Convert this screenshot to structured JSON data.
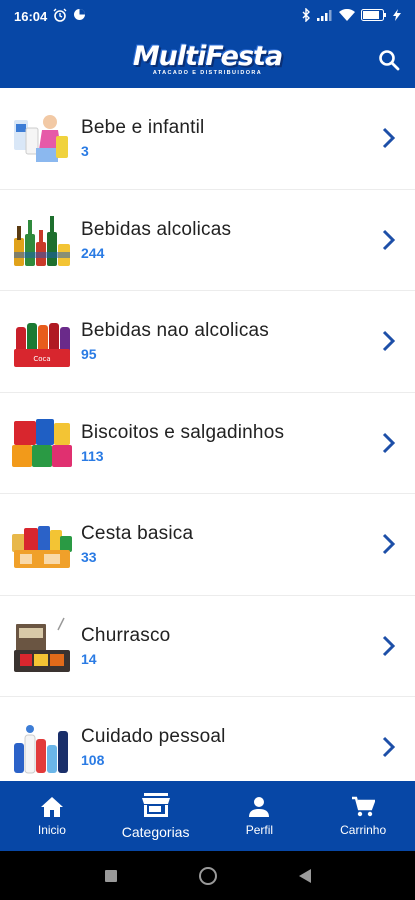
{
  "status_bar": {
    "time": "16:04"
  },
  "app_bar": {
    "logo_text_a": "Multi",
    "logo_text_b": "Festa",
    "logo_tagline": "ATACADO E DISTRIBUIDORA"
  },
  "categories": [
    {
      "name": "Bebe e infantil",
      "count": "3"
    },
    {
      "name": "Bebidas alcolicas",
      "count": "244"
    },
    {
      "name": "Bebidas nao alcolicas",
      "count": "95"
    },
    {
      "name": "Biscoitos e salgadinhos",
      "count": "113"
    },
    {
      "name": "Cesta basica",
      "count": "33"
    },
    {
      "name": "Churrasco",
      "count": "14"
    },
    {
      "name": "Cuidado pessoal",
      "count": "108"
    }
  ],
  "bottom_nav": [
    {
      "label": "Inicio",
      "icon": "home-icon"
    },
    {
      "label": "Categorias",
      "icon": "store-icon",
      "active": true
    },
    {
      "label": "Perfil",
      "icon": "person-icon"
    },
    {
      "label": "Carrinho",
      "icon": "cart-icon"
    }
  ],
  "colors": {
    "primary": "#0747a6",
    "count": "#2a7be4",
    "chevron": "#1d4fa8"
  }
}
